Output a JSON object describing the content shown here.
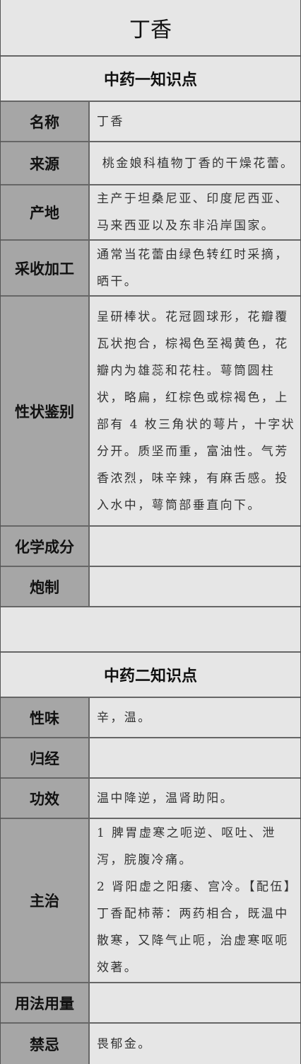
{
  "title": "丁香",
  "section1": {
    "header": "中药一知识点",
    "rows": [
      {
        "label": "名称",
        "value": "丁香"
      },
      {
        "label": "来源",
        "value": " 桃金娘科植物丁香的干燥花蕾。"
      },
      {
        "label": "产地",
        "value": "主产于坦桑尼亚、印度尼西亚、马来西亚以及东非沿岸国家。"
      },
      {
        "label": "采收加工",
        "value": "通常当花蕾由绿色转红时采摘，晒干。"
      },
      {
        "label": "性状鉴别",
        "value": "呈研棒状。花冠圆球形，花瓣覆瓦状抱合，棕褐色至褐黄色，花瓣内为雄蕊和花柱。萼筒圆柱状，略扁，红棕色或棕褐色，上部有 4 枚三角状的萼片，十字状分开。质坚而重，富油性。气芳香浓烈，味辛辣，有麻舌感。投入水中，萼筒部垂直向下。"
      },
      {
        "label": "化学成分",
        "value": ""
      },
      {
        "label": "炮制",
        "value": ""
      }
    ]
  },
  "section2": {
    "header": "中药二知识点",
    "rows": [
      {
        "label": "性味",
        "value": "辛，温。"
      },
      {
        "label": "归经",
        "value": ""
      },
      {
        "label": "功效",
        "value": "温中降逆，温肾助阳。"
      },
      {
        "label": "主治",
        "value": "1 脾胃虚寒之呃逆、呕吐、泄泻，脘腹冷痛。",
        "value2": "2 肾阳虚之阳痿、宫冷。【配伍】丁香配柿蒂：两药相合，既温中散寒，又降气止呃，治虚寒呕呃效著。"
      },
      {
        "label": "用法用量",
        "value": ""
      },
      {
        "label": "禁忌",
        "value": "畏郁金。"
      }
    ]
  }
}
